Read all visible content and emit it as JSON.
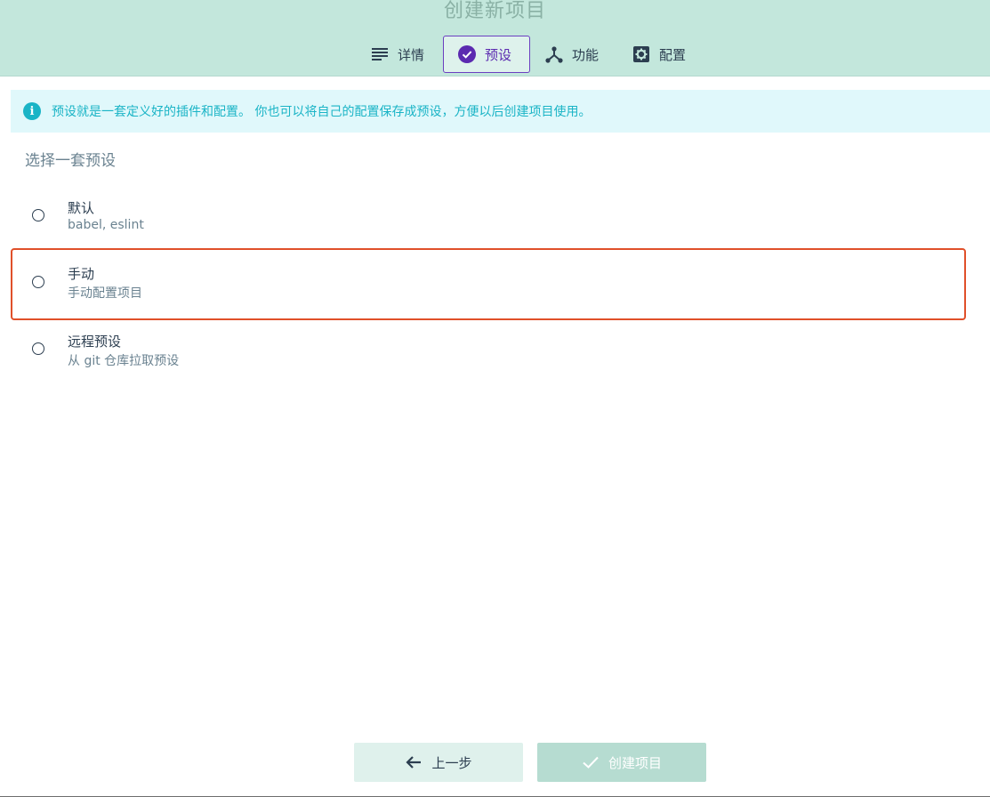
{
  "window": {
    "title": "创建新项目"
  },
  "tabs": [
    {
      "label": "详情",
      "icon": "list-icon"
    },
    {
      "label": "预设",
      "icon": "check-circle-icon",
      "active": true
    },
    {
      "label": "功能",
      "icon": "fork-icon"
    },
    {
      "label": "配置",
      "icon": "gear-icon"
    }
  ],
  "info": {
    "text": "预设就是一套定义好的插件和配置。 你也可以将自己的配置保存成预设，方便以后创建项目使用。",
    "icon": "info-icon"
  },
  "section": {
    "title": "选择一套预设"
  },
  "presets": [
    {
      "name": "默认",
      "description": "babel, eslint",
      "selected": false
    },
    {
      "name": "手动",
      "description": "手动配置项目",
      "selected": false,
      "highlighted": true
    },
    {
      "name": "远程预设",
      "description": "从 git 仓库拉取预设",
      "selected": false
    }
  ],
  "footer": {
    "prev_label": "上一步",
    "create_label": "创建项目",
    "create_disabled": true
  },
  "colors": {
    "header_bg": "#c3e7dc",
    "accent": "#5b2ab0",
    "info": "#1ab4c6",
    "highlight": "#e0502a"
  }
}
